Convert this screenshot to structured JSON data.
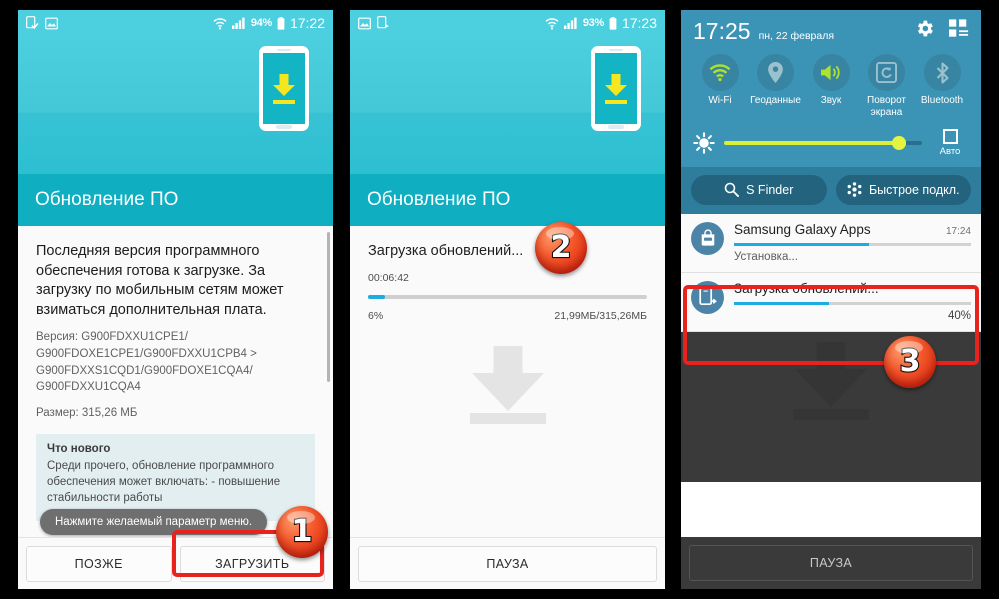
{
  "panel1": {
    "status": {
      "clock": "17:22",
      "battery": "94%",
      "icons": [
        "download-complete-icon",
        "screenshot-icon",
        "wifi-icon",
        "signal-icon",
        "battery-icon"
      ]
    },
    "title": "Обновление ПО",
    "lead": "Последняя версия программного обеспечения готова к загрузке. За загрузку по мобильным сетям может взиматься дополнительная плата.",
    "version_line": "Версия: G900FDXXU1CPE1/ G900FDOXE1CPE1/G900FDXXU1CPB4 > G900FDXXS1CQD1/G900FDOXE1CQA4/ G900FDXXU1CQA4",
    "size_line": "Размер: 315,26 МБ",
    "whatsnew_title": "Что нового",
    "whatsnew_body": "Среди прочего, обновление программного обеспечения может включать: - повышение стабильности работы",
    "tooltip": "Нажмите желаемый параметр меню.",
    "button_later": "ПОЗЖЕ",
    "button_download": "ЗАГРУЗИТЬ"
  },
  "panel2": {
    "status": {
      "clock": "17:23",
      "battery": "93%"
    },
    "title": "Обновление ПО",
    "download_title": "Загрузка обновлений...",
    "elapsed": "00:06:42",
    "percent": "6%",
    "percent_value": 6,
    "size_progress": "21,99МБ/315,26МБ",
    "button_pause": "ПАУЗА"
  },
  "panel3": {
    "quick": {
      "time": "17:25",
      "date": "пн, 22 февраля",
      "gear_icon": "gear-icon",
      "grid_icon": "quick-settings-grid-icon",
      "toggles": [
        {
          "label": "Wi-Fi",
          "icon": "wifi-icon",
          "on": true
        },
        {
          "label": "Геоданные",
          "icon": "location-pin-icon",
          "on": false
        },
        {
          "label": "Звук",
          "icon": "sound-icon",
          "on": true
        },
        {
          "label": "Поворот экрана",
          "icon": "screen-rotation-icon",
          "on": false
        },
        {
          "label": "Bluetooth",
          "icon": "bluetooth-icon",
          "on": false
        }
      ],
      "brightness_auto": "Авто",
      "brightness_value": 92,
      "s_finder": "S Finder",
      "quick_connect": "Быстрое подкл."
    },
    "notifications": [
      {
        "title": "Samsung Galaxy Apps",
        "time": "17:24",
        "sub": "Установка...",
        "percent_value": 57,
        "icon": "galaxy-apps-icon"
      },
      {
        "title": "Загрузка обновлений...",
        "time": "",
        "percent": "40%",
        "percent_value": 40,
        "icon": "software-update-icon"
      }
    ],
    "button_pause": "ПАУЗА"
  },
  "badges": {
    "one": "1",
    "two": "2",
    "three": "3"
  },
  "colors": {
    "accent_teal": "#0faec0",
    "hero_cyan": "#43c8d8",
    "progress_blue": "#1aaee0",
    "highlight_red": "#e8231e",
    "shade_blue": "#3b93b5",
    "shade_dark": "#2f7d9c",
    "brightness_yellow": "#d9ef38"
  }
}
